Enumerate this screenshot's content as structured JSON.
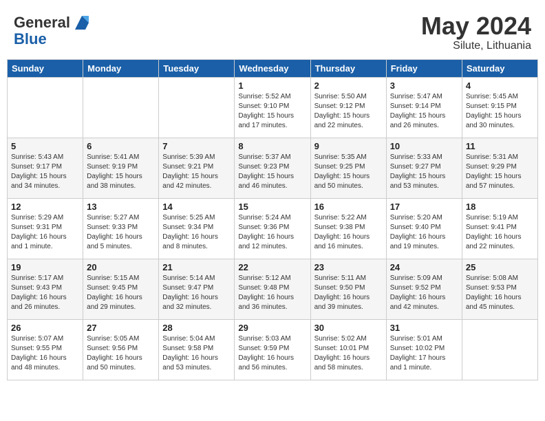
{
  "logo": {
    "line1": "General",
    "line2": "Blue"
  },
  "title": "May 2024",
  "subtitle": "Silute, Lithuania",
  "days_header": [
    "Sunday",
    "Monday",
    "Tuesday",
    "Wednesday",
    "Thursday",
    "Friday",
    "Saturday"
  ],
  "weeks": [
    [
      {
        "day": "",
        "info": ""
      },
      {
        "day": "",
        "info": ""
      },
      {
        "day": "",
        "info": ""
      },
      {
        "day": "1",
        "info": "Sunrise: 5:52 AM\nSunset: 9:10 PM\nDaylight: 15 hours\nand 17 minutes."
      },
      {
        "day": "2",
        "info": "Sunrise: 5:50 AM\nSunset: 9:12 PM\nDaylight: 15 hours\nand 22 minutes."
      },
      {
        "day": "3",
        "info": "Sunrise: 5:47 AM\nSunset: 9:14 PM\nDaylight: 15 hours\nand 26 minutes."
      },
      {
        "day": "4",
        "info": "Sunrise: 5:45 AM\nSunset: 9:15 PM\nDaylight: 15 hours\nand 30 minutes."
      }
    ],
    [
      {
        "day": "5",
        "info": "Sunrise: 5:43 AM\nSunset: 9:17 PM\nDaylight: 15 hours\nand 34 minutes."
      },
      {
        "day": "6",
        "info": "Sunrise: 5:41 AM\nSunset: 9:19 PM\nDaylight: 15 hours\nand 38 minutes."
      },
      {
        "day": "7",
        "info": "Sunrise: 5:39 AM\nSunset: 9:21 PM\nDaylight: 15 hours\nand 42 minutes."
      },
      {
        "day": "8",
        "info": "Sunrise: 5:37 AM\nSunset: 9:23 PM\nDaylight: 15 hours\nand 46 minutes."
      },
      {
        "day": "9",
        "info": "Sunrise: 5:35 AM\nSunset: 9:25 PM\nDaylight: 15 hours\nand 50 minutes."
      },
      {
        "day": "10",
        "info": "Sunrise: 5:33 AM\nSunset: 9:27 PM\nDaylight: 15 hours\nand 53 minutes."
      },
      {
        "day": "11",
        "info": "Sunrise: 5:31 AM\nSunset: 9:29 PM\nDaylight: 15 hours\nand 57 minutes."
      }
    ],
    [
      {
        "day": "12",
        "info": "Sunrise: 5:29 AM\nSunset: 9:31 PM\nDaylight: 16 hours\nand 1 minute."
      },
      {
        "day": "13",
        "info": "Sunrise: 5:27 AM\nSunset: 9:33 PM\nDaylight: 16 hours\nand 5 minutes."
      },
      {
        "day": "14",
        "info": "Sunrise: 5:25 AM\nSunset: 9:34 PM\nDaylight: 16 hours\nand 8 minutes."
      },
      {
        "day": "15",
        "info": "Sunrise: 5:24 AM\nSunset: 9:36 PM\nDaylight: 16 hours\nand 12 minutes."
      },
      {
        "day": "16",
        "info": "Sunrise: 5:22 AM\nSunset: 9:38 PM\nDaylight: 16 hours\nand 16 minutes."
      },
      {
        "day": "17",
        "info": "Sunrise: 5:20 AM\nSunset: 9:40 PM\nDaylight: 16 hours\nand 19 minutes."
      },
      {
        "day": "18",
        "info": "Sunrise: 5:19 AM\nSunset: 9:41 PM\nDaylight: 16 hours\nand 22 minutes."
      }
    ],
    [
      {
        "day": "19",
        "info": "Sunrise: 5:17 AM\nSunset: 9:43 PM\nDaylight: 16 hours\nand 26 minutes."
      },
      {
        "day": "20",
        "info": "Sunrise: 5:15 AM\nSunset: 9:45 PM\nDaylight: 16 hours\nand 29 minutes."
      },
      {
        "day": "21",
        "info": "Sunrise: 5:14 AM\nSunset: 9:47 PM\nDaylight: 16 hours\nand 32 minutes."
      },
      {
        "day": "22",
        "info": "Sunrise: 5:12 AM\nSunset: 9:48 PM\nDaylight: 16 hours\nand 36 minutes."
      },
      {
        "day": "23",
        "info": "Sunrise: 5:11 AM\nSunset: 9:50 PM\nDaylight: 16 hours\nand 39 minutes."
      },
      {
        "day": "24",
        "info": "Sunrise: 5:09 AM\nSunset: 9:52 PM\nDaylight: 16 hours\nand 42 minutes."
      },
      {
        "day": "25",
        "info": "Sunrise: 5:08 AM\nSunset: 9:53 PM\nDaylight: 16 hours\nand 45 minutes."
      }
    ],
    [
      {
        "day": "26",
        "info": "Sunrise: 5:07 AM\nSunset: 9:55 PM\nDaylight: 16 hours\nand 48 minutes."
      },
      {
        "day": "27",
        "info": "Sunrise: 5:05 AM\nSunset: 9:56 PM\nDaylight: 16 hours\nand 50 minutes."
      },
      {
        "day": "28",
        "info": "Sunrise: 5:04 AM\nSunset: 9:58 PM\nDaylight: 16 hours\nand 53 minutes."
      },
      {
        "day": "29",
        "info": "Sunrise: 5:03 AM\nSunset: 9:59 PM\nDaylight: 16 hours\nand 56 minutes."
      },
      {
        "day": "30",
        "info": "Sunrise: 5:02 AM\nSunset: 10:01 PM\nDaylight: 16 hours\nand 58 minutes."
      },
      {
        "day": "31",
        "info": "Sunrise: 5:01 AM\nSunset: 10:02 PM\nDaylight: 17 hours\nand 1 minute."
      },
      {
        "day": "",
        "info": ""
      }
    ]
  ]
}
